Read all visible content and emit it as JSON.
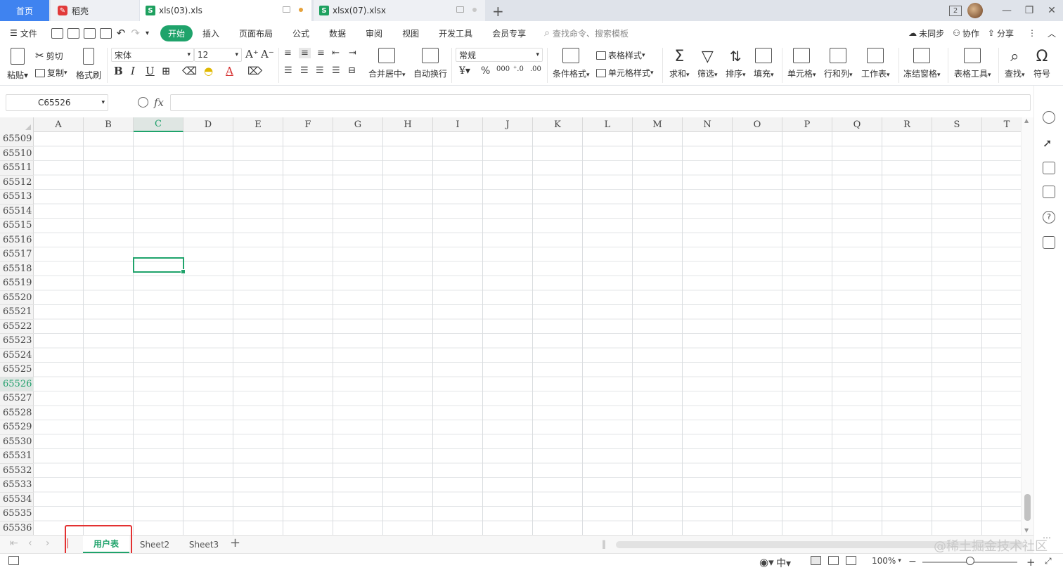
{
  "tabs": {
    "home": "首页",
    "daoke": "稻壳",
    "file1": "xls(03).xls",
    "file2": "xlsx(07).xlsx",
    "new_tab": "+",
    "badge": "2"
  },
  "menu": {
    "file": "文件",
    "items": [
      "开始",
      "插入",
      "页面布局",
      "公式",
      "数据",
      "审阅",
      "视图",
      "开发工具",
      "会员专享"
    ],
    "search_placeholder": "查找命令、搜索模板",
    "sync": "未同步",
    "collab": "协作",
    "share": "分享"
  },
  "ribbon": {
    "paste": "粘贴",
    "cut": "剪切",
    "copy": "复制",
    "format_painter": "格式刷",
    "font_name": "宋体",
    "font_size": "12",
    "merge_center": "合并居中",
    "wrap_text": "自动换行",
    "number_format": "常规",
    "conditional_format": "条件格式",
    "table_style": "表格样式",
    "cell_style": "单元格样式",
    "sum": "求和",
    "filter": "筛选",
    "sort": "排序",
    "fill": "填充",
    "cell": "单元格",
    "row_col": "行和列",
    "worksheet": "工作表",
    "freeze": "冻结窗格",
    "table_tools": "表格工具",
    "find": "查找",
    "symbol": "符号"
  },
  "formula": {
    "name_box": "C65526",
    "fx": "fx",
    "value": ""
  },
  "grid": {
    "columns": [
      "A",
      "B",
      "C",
      "D",
      "E",
      "F",
      "G",
      "H",
      "I",
      "J",
      "K",
      "L",
      "M",
      "N",
      "O",
      "P",
      "Q",
      "R",
      "S",
      "T"
    ],
    "active_column": "C",
    "rows": [
      "65509",
      "65510",
      "65511",
      "65512",
      "65513",
      "65514",
      "65515",
      "65516",
      "65517",
      "65518",
      "65519",
      "65520",
      "65521",
      "65522",
      "65523",
      "65524",
      "65525",
      "65526",
      "65527",
      "65528",
      "65529",
      "65530",
      "65531",
      "65532",
      "65533",
      "65534",
      "65535",
      "65536"
    ],
    "active_row": "65526"
  },
  "sheets": {
    "tabs": [
      "用户表",
      "Sheet2",
      "Sheet3"
    ],
    "active": "用户表",
    "add": "+"
  },
  "status": {
    "zoom": "100%",
    "minus": "−",
    "plus": "+"
  },
  "watermark": "@稀土掘金技术社区",
  "colors": {
    "accent": "#1fa36b",
    "home_tab": "#3f83f0",
    "highlight": "#e33131"
  }
}
